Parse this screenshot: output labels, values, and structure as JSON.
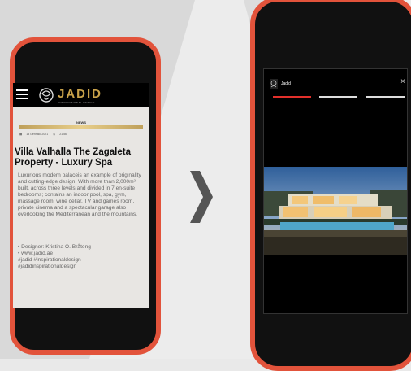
{
  "colors": {
    "accent": "#e2533b",
    "gold": "#c9a24a",
    "progress_active": "#e2302b"
  },
  "left_phone": {
    "header": {
      "menu_icon": "hamburger-icon",
      "logo_text": "JADID",
      "logo_subtitle": "INSPIRATIONAL DESIGN"
    },
    "section_label": "NEWS",
    "meta": {
      "date": "18 Gennaio 2021",
      "time": "21:56"
    },
    "article": {
      "title": "Villa Valhalla The Zagaleta Property - Luxury Spa",
      "body": "Luxurious modern palaceis an example of originality and cutting-edge design. With more than 2,000m² built, across three levels and divided in 7 en-suite bedrooms; contains an indoor pool, spa, gym, massage room, wine cellar, TV and games room, private cinema and a spectacular garage also overlooking the Mediterranean and the mountains.",
      "meta_lines": [
        "• Designer: Kristina O. Bråteng",
        "• www.jadid.ae",
        "#jadid #inspirationaldesign",
        "#jadidinspirationaldesign"
      ]
    }
  },
  "arrow": "chevron-right-icon",
  "right_phone": {
    "story": {
      "account_name": "Jadid",
      "close_label": "×",
      "progress": [
        1,
        0,
        0
      ]
    }
  }
}
